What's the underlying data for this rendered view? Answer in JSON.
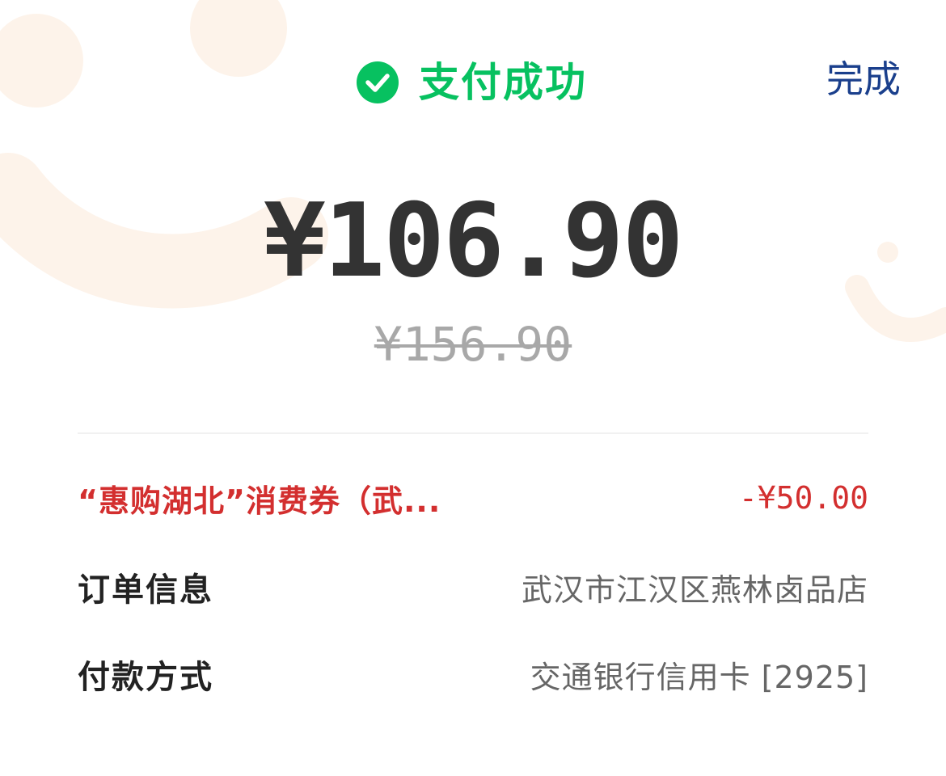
{
  "header": {
    "status_text": "支付成功",
    "done_label": "完成"
  },
  "payment": {
    "amount": "¥106.90",
    "original_amount": "¥156.90"
  },
  "details": {
    "coupon_label": "“惠购湖北”消费券（武...",
    "coupon_value": "-¥50.00",
    "order_label": "订单信息",
    "order_value": "武汉市江汉区燕林卤品店",
    "payment_method_label": "付款方式",
    "payment_method_value": "交通银行信用卡 [2925]"
  },
  "icons": {
    "status": "check-circle-icon",
    "background": "smiley-decoration"
  },
  "colors": {
    "success_green": "#07c160",
    "done_blue": "#1a3f8c",
    "discount_red": "#d32f2f",
    "amount_text": "#333333",
    "decoration": "#fdf3ea"
  }
}
